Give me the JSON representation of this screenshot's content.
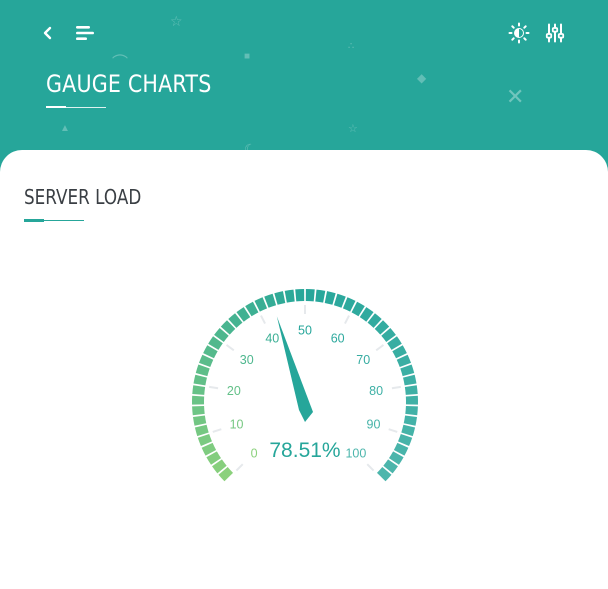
{
  "header": {
    "title": "GAUGE CHARTS",
    "background_color": "#26a69a",
    "icons": {
      "back": "chevron-left-icon",
      "menu": "menu-icon",
      "theme": "sun-icon",
      "settings": "sliders-icon"
    }
  },
  "card": {
    "title": "SERVER LOAD",
    "accent_color": "#26a69a"
  },
  "chart_data": {
    "type": "gauge",
    "title": "",
    "min": 0,
    "max": 100,
    "value": 78.51,
    "value_label": "78.51%",
    "ticks": [
      0,
      10,
      20,
      30,
      40,
      50,
      60,
      70,
      80,
      90,
      100
    ],
    "tick_labels": [
      "0",
      "10",
      "20",
      "30",
      "40",
      "50",
      "60",
      "70",
      "80",
      "90",
      "100"
    ],
    "color_start": "#8bd17c",
    "color_end": "#26a69a",
    "pointer_color": "#26a69a"
  }
}
